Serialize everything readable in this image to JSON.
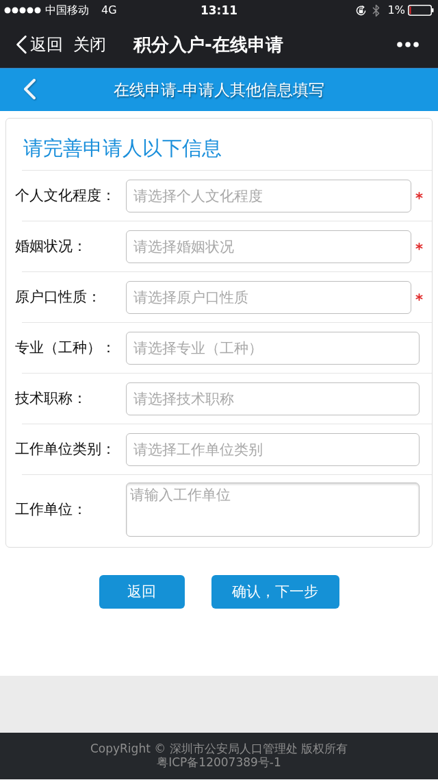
{
  "status_bar": {
    "carrier": "中国移动",
    "network": "4G",
    "time": "13:11",
    "battery": "1%"
  },
  "nav_bar": {
    "back": "返回",
    "close": "关闭",
    "title": "积分入户-在线申请"
  },
  "page_header": {
    "title": "在线申请-申请人其他信息填写"
  },
  "form": {
    "heading": "请完善申请人以下信息",
    "fields": [
      {
        "label": "个人文化程度：",
        "placeholder": "请选择个人文化程度",
        "required": true,
        "kind": "select"
      },
      {
        "label": "婚姻状况：",
        "placeholder": "请选择婚姻状况",
        "required": true,
        "kind": "select"
      },
      {
        "label": "原户口性质：",
        "placeholder": "请选择原户口性质",
        "required": true,
        "kind": "select"
      },
      {
        "label": "专业（工种）：",
        "placeholder": "请选择专业（工种）",
        "required": false,
        "kind": "select"
      },
      {
        "label": "技术职称：",
        "placeholder": "请选择技术职称",
        "required": false,
        "kind": "select"
      },
      {
        "label": "工作单位类别：",
        "placeholder": "请选择工作单位类别",
        "required": false,
        "kind": "select"
      },
      {
        "label": "工作单位：",
        "placeholder": "请输入工作单位",
        "required": false,
        "kind": "textarea"
      }
    ]
  },
  "buttons": [
    "返回",
    "确认，下一步"
  ],
  "footer": {
    "copyright": "CopyRight © 深圳市公安局人口管理处 版权所有",
    "icp": "粤ICP备12007389号-1"
  }
}
